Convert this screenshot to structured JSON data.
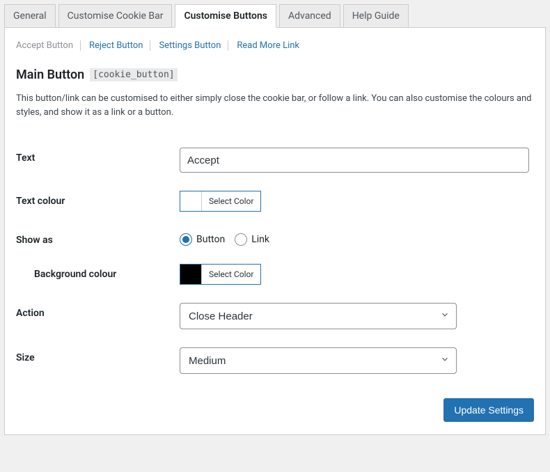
{
  "top_tabs": {
    "general": "General",
    "customise_bar": "Customise Cookie Bar",
    "customise_buttons": "Customise Buttons",
    "advanced": "Advanced",
    "help": "Help Guide"
  },
  "sub_tabs": {
    "accept": "Accept Button",
    "reject": "Reject Button",
    "settings": "Settings Button",
    "readmore": "Read More Link"
  },
  "heading": {
    "title": "Main Button",
    "shortcode": "[cookie_button]"
  },
  "description": "This button/link can be customised to either simply close the cookie bar, or follow a link. You can also customise the colours and styles, and show it as a link or a button.",
  "fields": {
    "text_label": "Text",
    "text_value": "Accept",
    "text_colour_label": "Text colour",
    "text_colour_button": "Select Color",
    "text_colour_value": "#ffffff",
    "show_as_label": "Show as",
    "show_as_button": "Button",
    "show_as_link": "Link",
    "bg_colour_label": "Background colour",
    "bg_colour_button": "Select Color",
    "bg_colour_value": "#000000",
    "action_label": "Action",
    "action_value": "Close Header",
    "size_label": "Size",
    "size_value": "Medium"
  },
  "submit_label": "Update Settings"
}
